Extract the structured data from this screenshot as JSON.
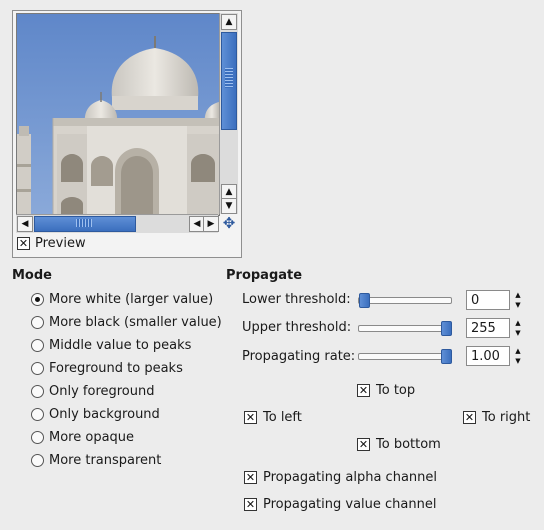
{
  "preview": {
    "label": "Preview",
    "checked": true
  },
  "mode": {
    "heading": "Mode",
    "options": [
      {
        "label": "More white (larger value)",
        "selected": true
      },
      {
        "label": "More black (smaller value)",
        "selected": false
      },
      {
        "label": "Middle value to peaks",
        "selected": false
      },
      {
        "label": "Foreground to peaks",
        "selected": false
      },
      {
        "label": "Only foreground",
        "selected": false
      },
      {
        "label": "Only background",
        "selected": false
      },
      {
        "label": "More opaque",
        "selected": false
      },
      {
        "label": "More transparent",
        "selected": false
      }
    ]
  },
  "propagate": {
    "heading": "Propagate",
    "lower_threshold": {
      "label": "Lower threshold:",
      "value": "0",
      "fraction": 0.0
    },
    "upper_threshold": {
      "label": "Upper threshold:",
      "value": "255",
      "fraction": 1.0
    },
    "propagating_rate": {
      "label": "Propagating rate:",
      "value": "1.00",
      "fraction": 1.0
    },
    "directions": {
      "to_top": {
        "label": "To top",
        "checked": true
      },
      "to_left": {
        "label": "To left",
        "checked": true
      },
      "to_right": {
        "label": "To right",
        "checked": true
      },
      "to_bottom": {
        "label": "To bottom",
        "checked": true
      }
    },
    "alpha_channel": {
      "label": "Propagating alpha channel",
      "checked": true
    },
    "value_channel": {
      "label": "Propagating value channel",
      "checked": true
    }
  },
  "icons": {
    "arrow_up": "▲",
    "arrow_down": "▼",
    "arrow_left": "◀",
    "arrow_right": "▶",
    "navigate": "✥",
    "check": "✕"
  }
}
